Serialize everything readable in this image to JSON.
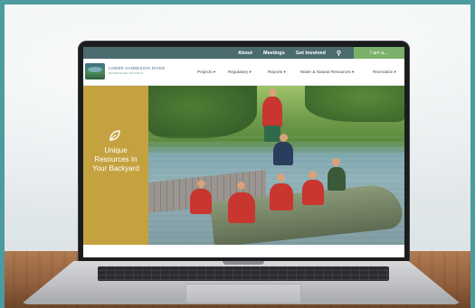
{
  "site": {
    "topbar": {
      "links": [
        "About",
        "Meetings",
        "Get Involved"
      ],
      "iam_label": "I am a..."
    },
    "logo": {
      "line1": "LOWER HANNESOTA RIVER",
      "line2": "WATERSHED DISTRICT"
    },
    "nav": [
      "Projects ▾",
      "Regulatory ▾",
      "Reports ▾",
      "Water & Natural Resources ▾",
      "Recreation ▾"
    ],
    "hero": {
      "heading": "Unique Resources In Your Backyard"
    }
  },
  "colors": {
    "topbar": "#4b6b6e",
    "iam_button": "#7ab06a",
    "hero_panel": "#c4a23f",
    "frame": "#4d9aa0"
  },
  "icons": {
    "search": "search-icon",
    "hero": "leaf-icon"
  }
}
